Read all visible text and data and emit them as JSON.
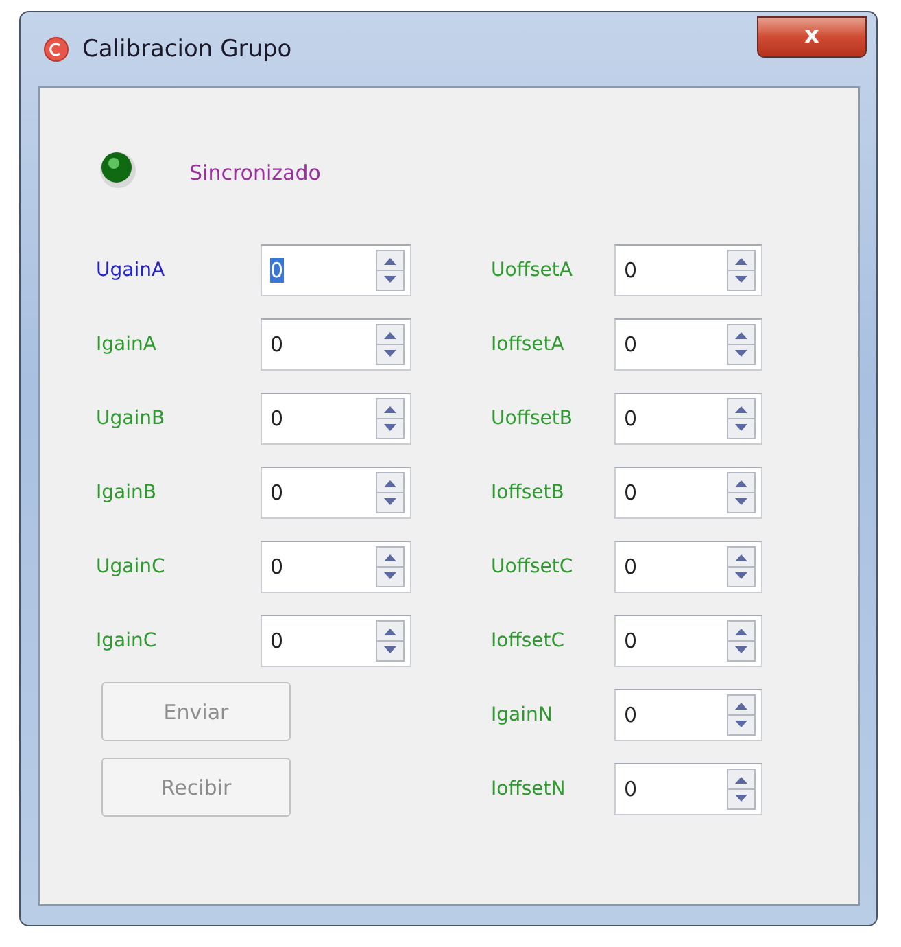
{
  "window": {
    "title": "Calibracion Grupo",
    "close": "x"
  },
  "status": {
    "text": "Sincronizado",
    "on": true
  },
  "left_fields": [
    {
      "label": "UgainA",
      "value": "0",
      "focused": true
    },
    {
      "label": "IgainA",
      "value": "0",
      "focused": false
    },
    {
      "label": "UgainB",
      "value": "0",
      "focused": false
    },
    {
      "label": "IgainB",
      "value": "0",
      "focused": false
    },
    {
      "label": "UgainC",
      "value": "0",
      "focused": false
    },
    {
      "label": "IgainC",
      "value": "0",
      "focused": false
    }
  ],
  "buttons": [
    {
      "label": "Enviar",
      "disabled": true
    },
    {
      "label": "Recibir",
      "disabled": true
    }
  ],
  "right_fields": [
    {
      "label": "UoffsetA",
      "value": "0",
      "focused": false
    },
    {
      "label": "IoffsetA",
      "value": "0",
      "focused": false
    },
    {
      "label": "UoffsetB",
      "value": "0",
      "focused": false
    },
    {
      "label": "IoffsetB",
      "value": "0",
      "focused": false
    },
    {
      "label": "UoffsetC",
      "value": "0",
      "focused": false
    },
    {
      "label": "IoffsetC",
      "value": "0",
      "focused": false
    },
    {
      "label": "IgainN",
      "value": "0",
      "focused": false
    },
    {
      "label": "IoffsetN",
      "value": "0",
      "focused": false
    }
  ]
}
